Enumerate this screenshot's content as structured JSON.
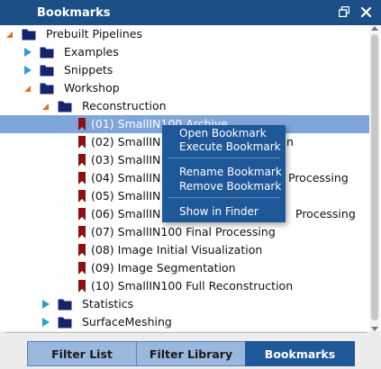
{
  "window": {
    "title": "Bookmarks",
    "float_icon": "float-window-icon",
    "close_icon": "close-icon"
  },
  "tree": [
    {
      "label": "Prebuilt Pipelines",
      "type": "folder",
      "level": 0,
      "expanded": true
    },
    {
      "label": "Examples",
      "type": "folder",
      "level": 1,
      "expanded": false
    },
    {
      "label": "Snippets",
      "type": "folder",
      "level": 1,
      "expanded": false
    },
    {
      "label": "Workshop",
      "type": "folder",
      "level": 1,
      "expanded": true
    },
    {
      "label": "Reconstruction",
      "type": "folder",
      "level": 2,
      "expanded": true
    },
    {
      "label": "(01) SmallIN100 Archive",
      "type": "bookmark",
      "level": 3,
      "selected": true
    },
    {
      "label": "(02) SmallIN",
      "label_tail": "n",
      "type": "bookmark",
      "level": 3
    },
    {
      "label": "(03) SmallIN",
      "type": "bookmark",
      "level": 3
    },
    {
      "label": "(04) SmallIN",
      "label_tail": "Processing",
      "type": "bookmark",
      "level": 3
    },
    {
      "label": "(05) SmallIN",
      "type": "bookmark",
      "level": 3
    },
    {
      "label": "(06) SmallIN",
      "label_tail": "Processing",
      "type": "bookmark",
      "level": 3
    },
    {
      "label": "(07) SmallIN100 Final Processing",
      "type": "bookmark",
      "level": 3
    },
    {
      "label": "(08) Image Initial Visualization",
      "type": "bookmark",
      "level": 3
    },
    {
      "label": "(09) Image Segmentation",
      "type": "bookmark",
      "level": 3
    },
    {
      "label": "(10) SmallIN100 Full Reconstruction",
      "type": "bookmark",
      "level": 3
    },
    {
      "label": "Statistics",
      "type": "folder",
      "level": 2,
      "expanded": false
    },
    {
      "label": "SurfaceMeshing",
      "type": "folder",
      "level": 2,
      "expanded": false
    }
  ],
  "context_menu": {
    "items": [
      "Open Bookmark",
      "Execute Bookmark",
      "Rename Bookmark",
      "Remove Bookmark",
      "Show in Finder"
    ]
  },
  "tabs": [
    {
      "label": "Filter List",
      "active": false
    },
    {
      "label": "Filter Library",
      "active": false
    },
    {
      "label": "Bookmarks",
      "active": true
    }
  ],
  "colors": {
    "title_bar": "#1d4f87",
    "selection": "#7fa5d9",
    "menu": "#1f5898",
    "folder": "#13246b",
    "bookmark": "#8b1111",
    "expand_collapsed": "#2e9bd8",
    "expand_expanded": "#e86c1f"
  }
}
